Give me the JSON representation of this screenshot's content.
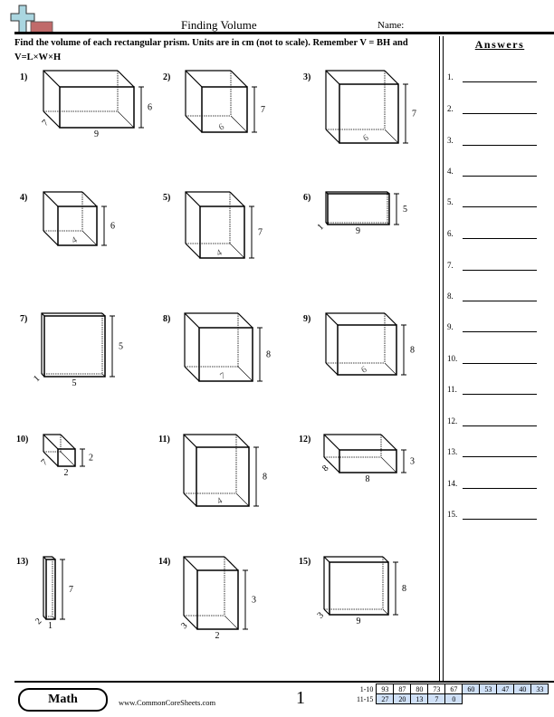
{
  "header": {
    "title": "Finding Volume",
    "name_label": "Name:",
    "logo_icon": "plus-sign-logo",
    "instructions": "Find the volume of each rectangular prism. Units are in cm (not to scale). Remember V = BH and V=L×W×H"
  },
  "answers": {
    "title": "Answers",
    "items": [
      "1.",
      "2.",
      "3.",
      "4.",
      "5.",
      "6.",
      "7.",
      "8.",
      "9.",
      "10.",
      "11.",
      "12.",
      "13.",
      "14.",
      "15."
    ]
  },
  "problems": [
    {
      "label": "1)",
      "length": "9",
      "width": "7",
      "height": "6"
    },
    {
      "label": "2)",
      "width": "6",
      "height": "7"
    },
    {
      "label": "3)",
      "width": "6",
      "height": "7"
    },
    {
      "label": "4)",
      "width": "4",
      "height": "6"
    },
    {
      "label": "5)",
      "width": "4",
      "height": "7"
    },
    {
      "label": "6)",
      "length": "9",
      "width": "1",
      "height": "5"
    },
    {
      "label": "7)",
      "length": "5",
      "width": "1",
      "height": "5"
    },
    {
      "label": "8)",
      "width": "7",
      "height": "8"
    },
    {
      "label": "9)",
      "width": "6",
      "height": "8"
    },
    {
      "label": "10)",
      "length": "2",
      "width": "7",
      "height": "2"
    },
    {
      "label": "11)",
      "width": "4",
      "height": "8"
    },
    {
      "label": "12)",
      "length": "8",
      "width": "8",
      "height": "3"
    },
    {
      "label": "13)",
      "length": "1",
      "width": "2",
      "height": "7"
    },
    {
      "label": "14)",
      "length": "2",
      "width": "3",
      "height": "3"
    },
    {
      "label": "15)",
      "length": "9",
      "width": "3",
      "height": "8"
    }
  ],
  "footer": {
    "badge": "Math",
    "site": "www.CommonCoreSheets.com",
    "page": "1",
    "score_key": {
      "row1_label": "1-10",
      "row1": [
        "93",
        "87",
        "80",
        "73",
        "67",
        "60",
        "53",
        "47",
        "40",
        "33"
      ],
      "row2_label": "11-15",
      "row2": [
        "27",
        "20",
        "13",
        "7",
        "0"
      ]
    }
  }
}
